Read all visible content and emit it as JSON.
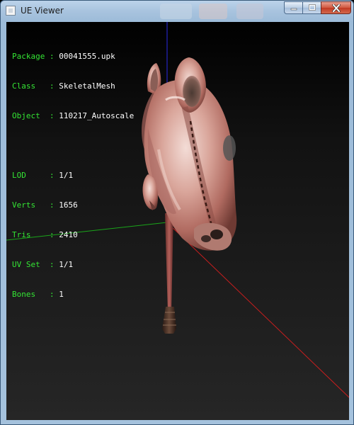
{
  "window": {
    "title": "UE Viewer",
    "icon": "app-window-icon",
    "buttons": [
      "minimize-icon",
      "maximize-icon",
      "close-icon"
    ]
  },
  "colors": {
    "hud_label": "#34e534",
    "hud_value": "#ffffff",
    "axis_x": "#c81e1e",
    "axis_y": "#1aa51a",
    "axis_z": "#2a2ae6",
    "viewport_bg_top": "#000000",
    "viewport_bg_bottom": "#262626"
  },
  "hud": {
    "info": [
      {
        "label": "Package",
        "sep": ":",
        "value": "00041555.upk"
      },
      {
        "label": "Class  ",
        "sep": ":",
        "value": "SkeletalMesh"
      },
      {
        "label": "Object ",
        "sep": ":",
        "value": "110217_Autoscale"
      }
    ],
    "stats": [
      {
        "label": "LOD    ",
        "sep": ":",
        "value": "1/1"
      },
      {
        "label": "Verts  ",
        "sep": ":",
        "value": "1656"
      },
      {
        "label": "Tris   ",
        "sep": ":",
        "value": "2410"
      },
      {
        "label": "UV Set ",
        "sep": ":",
        "value": "1/1"
      },
      {
        "label": "Bones  ",
        "sep": ":",
        "value": "1"
      }
    ]
  },
  "viewport": {
    "model": "hobby-horse-mesh"
  }
}
